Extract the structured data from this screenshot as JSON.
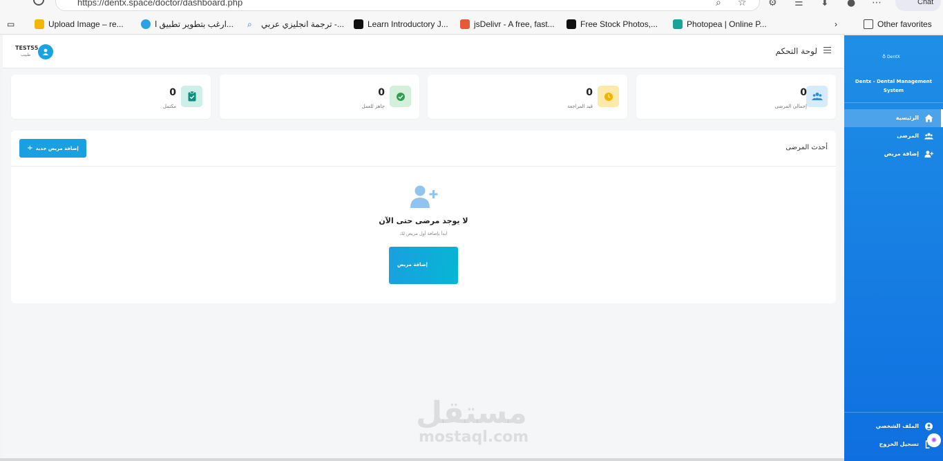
{
  "browser": {
    "url": "https://dentx.space/doctor/dashboard.php",
    "chat_label": "Chat",
    "bookmarks": [
      {
        "label": "Upload Image – re...",
        "color": "#f2b705"
      },
      {
        "label": "ارغب بتطوير تطبيق ا...",
        "color": "#2aa3e6"
      },
      {
        "label": "ترجمة انجليزي عربي -...",
        "color": "#1a73e8"
      },
      {
        "label": "Learn Introductory J...",
        "color": "#111111"
      },
      {
        "label": "jsDelivr - A free, fast...",
        "color": "#e8583a"
      },
      {
        "label": "Free Stock Photos,...",
        "color": "#111111"
      },
      {
        "label": "Photopea | Online P...",
        "color": "#18a497"
      }
    ],
    "other_favorites": "Other favorites"
  },
  "topbar": {
    "page_title": "لوحة التحكم",
    "user_name": "TEST55",
    "user_role": "طبيب"
  },
  "stats": [
    {
      "value": "0",
      "label": "إجمالي المرضى",
      "icon": "users-icon",
      "bg": "#d6ebfb",
      "fg": "#2a8de0"
    },
    {
      "value": "0",
      "label": "قيد المراجعة",
      "icon": "clock-icon",
      "bg": "#fde9a9",
      "fg": "#f0b400"
    },
    {
      "value": "0",
      "label": "جاهز للعمل",
      "icon": "check-circle-icon",
      "bg": "#d4f0db",
      "fg": "#2f9e4f"
    },
    {
      "value": "0",
      "label": "مكتمل",
      "icon": "clipboard-check-icon",
      "bg": "#cdeee9",
      "fg": "#0f8f80"
    }
  ],
  "recent": {
    "title": "أحدث المرضى",
    "add_new_label": "إضافة مريض جديد",
    "empty_title": "لا يوجد مرضى حتى الآن",
    "empty_subtitle": "ابدأ بإضافة أول مريض لك",
    "add_label": "إضافة مريض"
  },
  "sidebar": {
    "logo_text": "DentX",
    "system_name": "Dentx - Dental Management System",
    "items": [
      {
        "label": "الرئيسية",
        "icon": "home-icon",
        "active": true
      },
      {
        "label": "المرضى",
        "icon": "users-icon",
        "active": false
      },
      {
        "label": "إضافة مريض",
        "icon": "user-plus-icon",
        "active": false
      }
    ],
    "bottom_items": [
      {
        "label": "الملف الشخصي",
        "icon": "user-circle-icon"
      },
      {
        "label": "تسجيل الخروج",
        "icon": "logout-icon"
      }
    ]
  },
  "watermark": {
    "arabic": "مستقل",
    "latin": "mostaql.com"
  }
}
